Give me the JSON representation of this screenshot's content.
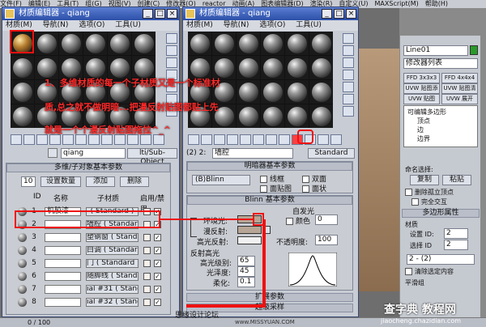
{
  "app": {
    "menu": [
      "文件(F)",
      "编辑(E)",
      "工具(T)",
      "组(G)",
      "视图(V)",
      "创建(C)",
      "修改器(O)",
      "reactor",
      "动画(A)",
      "图表编辑器(D)",
      "渲染(R)",
      "自定义(U)",
      "MAXScript(M)",
      "帮助(H)"
    ]
  },
  "editor1": {
    "title": "材质编辑器 - qiang",
    "menu": [
      "材质(M)",
      "导航(N)",
      "选项(O)",
      "工具(U)"
    ],
    "name_value": "qiang",
    "type_label": "lti/Sub-Object",
    "section_title": "多维/子对象基本参数",
    "count": "10",
    "set_count_label": "设置数量",
    "add_label": "添加",
    "delete_label": "删除",
    "col_id": "ID",
    "col_name": "名称",
    "col_sub": "子材质",
    "col_enable": "启用/禁用",
    "rows": [
      {
        "id": "1",
        "name": "机胶漆",
        "mat": "( Standard )"
      },
      {
        "id": "2",
        "name": "",
        "mat": "墙腔  ( Standard )"
      },
      {
        "id": "3",
        "name": "",
        "mat": "塑钢窗  ( Standard )"
      },
      {
        "id": "4",
        "name": "",
        "mat": "白调  ( Standard )"
      },
      {
        "id": "5",
        "name": "",
        "mat": "门  ( Standard )"
      },
      {
        "id": "6",
        "name": "",
        "mat": "随脚线  ( Standard )"
      },
      {
        "id": "7",
        "name": "",
        "mat": "ial #31  ( Standard )"
      },
      {
        "id": "8",
        "name": "",
        "mat": "ial #32  ( Standard )"
      }
    ]
  },
  "editor2": {
    "title": "材质编辑器 - qiang",
    "menu": [
      "材质(M)",
      "导航(N)",
      "选项(O)",
      "工具(U)"
    ],
    "slot_label": "(2) 2:",
    "name_value": "墙腔",
    "type_label": "Standard",
    "shader_section": "明暗器基本参数",
    "shader_value": "(B)Blinn",
    "wire": "线框",
    "two_sided": "双面",
    "face_map": "面贴图",
    "faceted": "面状",
    "blinn_section": "Blinn 基本参数",
    "self_illum": "自发光",
    "color_label": "颜色",
    "color_value": "0",
    "ambient": "环境光:",
    "diffuse": "漫反射:",
    "specular": "高光反射:",
    "opacity_label": "不透明度:",
    "opacity_value": "100",
    "spec_section": "反射高光",
    "spec_level_label": "高光级别:",
    "spec_level": "65",
    "gloss_label": "光泽度:",
    "gloss": "45",
    "soften_label": "柔化:",
    "soften": "0.1",
    "expand1": "扩展参数",
    "expand2": "超级采样"
  },
  "annotation": {
    "line1": "1、多维材质的每一个子材质又是一个标准材",
    "line2": "质,总之就不做明暗...把漫反射贴图都贴上先",
    "line3": "就是一个个漫反射贴图拖拉^_^"
  },
  "watermark": {
    "left": "思缘设计论坛",
    "left_url": "www.MISSYUAN.COM",
    "right": "查字典 教程网",
    "right_url": "jiaocheng.chazidian.com"
  },
  "command_panel": {
    "object_name": "Line01",
    "modifier_list": "修改器列表",
    "buttons": [
      "FFD 3x3x3",
      "FFD 4x4x4",
      "UVW 贴图添加",
      "UVW 贴图清除",
      "UVW 贴图",
      "UVW 展开"
    ],
    "stack": [
      "可编辑多边形",
      "顶点",
      "边",
      "边界"
    ],
    "named_sel": "命名选择:",
    "copy": "复制",
    "paste": "粘贴",
    "delete_isolated": "删除孤立顶点",
    "full_interact": "完全交互",
    "poly_props": "多边形属性",
    "material": "材质",
    "set_id_label": "设置 ID:",
    "set_id": "2",
    "select_id_label": "选择 ID",
    "select_id": "2",
    "dropdown": "2 - (2)",
    "clear_sel": "清除选定内容",
    "smooth": "平滑组"
  },
  "timeline": {
    "frame": "0 / 100"
  }
}
